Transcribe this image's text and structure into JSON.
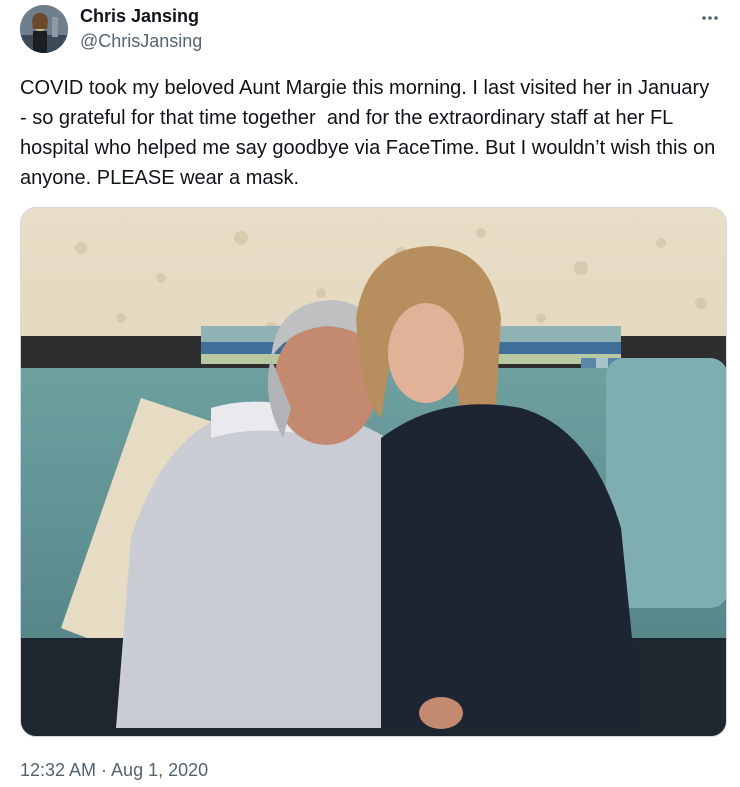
{
  "author": {
    "display_name": "Chris Jansing",
    "handle": "@ChrisJansing"
  },
  "tweet": {
    "text": "COVID took my beloved Aunt Margie this morning. I last visited her in January - so grateful for that time together  and for the extraordinary staff at her FL hospital who helped me say goodbye via FaceTime. But I wouldn’t wish this on anyone. PLEASE wear a mask.",
    "timestamp": "12:32 AM · Aug 1, 2020"
  },
  "icons": {
    "more": "more-icon"
  },
  "colors": {
    "primary_text": "#0f1419",
    "secondary_text": "#536471",
    "border": "#cfd9de"
  }
}
